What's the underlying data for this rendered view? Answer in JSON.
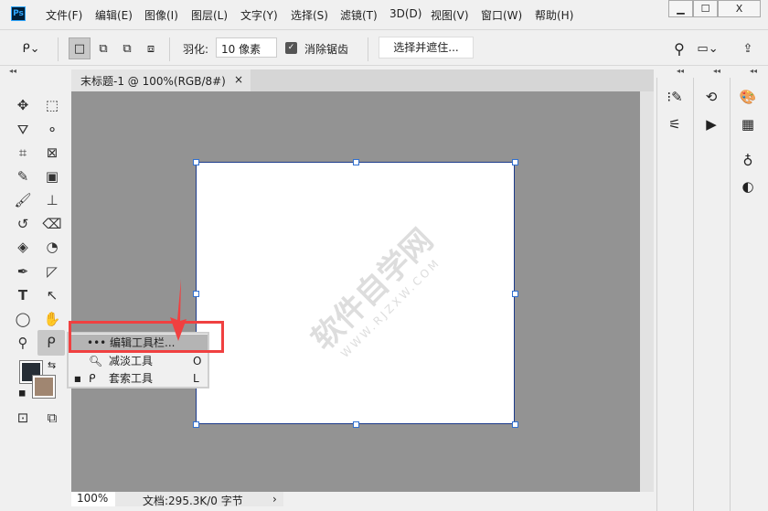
{
  "app": {
    "logo": "Ps"
  },
  "menu": [
    "文件(F)",
    "编辑(E)",
    "图像(I)",
    "图层(L)",
    "文字(Y)",
    "选择(S)",
    "滤镜(T)",
    "3D(D)",
    "视图(V)",
    "窗口(W)",
    "帮助(H)"
  ],
  "window": {
    "minimize": "▁",
    "maximize": "☐",
    "close": "X"
  },
  "options": {
    "feather_label": "羽化:",
    "feather_value": "10 像素",
    "antialias_label": "消除锯齿",
    "antialias_checked": true,
    "select_mask": "选择并遮住..."
  },
  "tab": {
    "title": "末标题-1 @ 100%(RGB/8#)",
    "close": "×"
  },
  "popup": {
    "items": [
      {
        "label": "••• 编辑工具栏...",
        "key": ""
      },
      {
        "label": "减淡工具",
        "key": "O"
      },
      {
        "label": "套索工具",
        "key": "L"
      }
    ]
  },
  "watermark": {
    "line1": "软件自学网",
    "line2": "WWW.RJZXW.COM"
  },
  "status": {
    "zoom": "100%",
    "doc": "文档:295.3K/0 字节",
    "arrow": "›"
  },
  "colors": {
    "foreground": "#262e36",
    "background": "#a08671",
    "highlight": "#f04040"
  }
}
